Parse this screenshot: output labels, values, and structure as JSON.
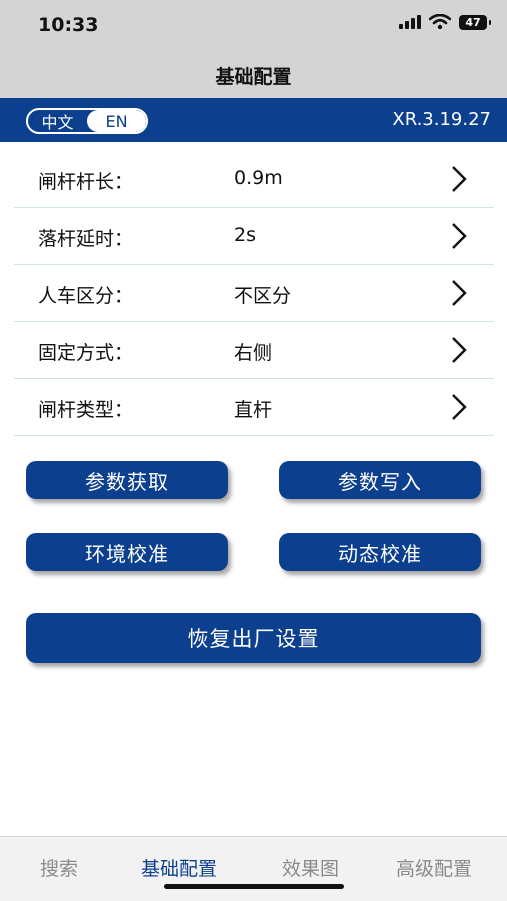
{
  "status": {
    "time": "10:33",
    "battery": "47"
  },
  "nav": {
    "title": "基础配置"
  },
  "header": {
    "lang_cn": "中文",
    "lang_en": "EN",
    "version": "XR.3.19.27"
  },
  "settings": [
    {
      "label": "闸杆杆长：",
      "value": "0.9m"
    },
    {
      "label": "落杆延时：",
      "value": "2s"
    },
    {
      "label": "人车区分：",
      "value": "不区分"
    },
    {
      "label": "固定方式：",
      "value": "右侧"
    },
    {
      "label": "闸杆类型：",
      "value": "直杆"
    }
  ],
  "buttons": {
    "get_params": "参数获取",
    "write_params": "参数写入",
    "env_calibrate": "环境校准",
    "dynamic_calibrate": "动态校准",
    "factory_reset": "恢复出厂设置"
  },
  "tabs": [
    "搜索",
    "基础配置",
    "效果图",
    "高级配置"
  ],
  "colors": {
    "primary": "#0d3f8f",
    "divider": "#cfe3e8"
  },
  "icons": [
    "signal-icon",
    "wifi-icon",
    "battery-icon",
    "chevron-right-icon"
  ]
}
